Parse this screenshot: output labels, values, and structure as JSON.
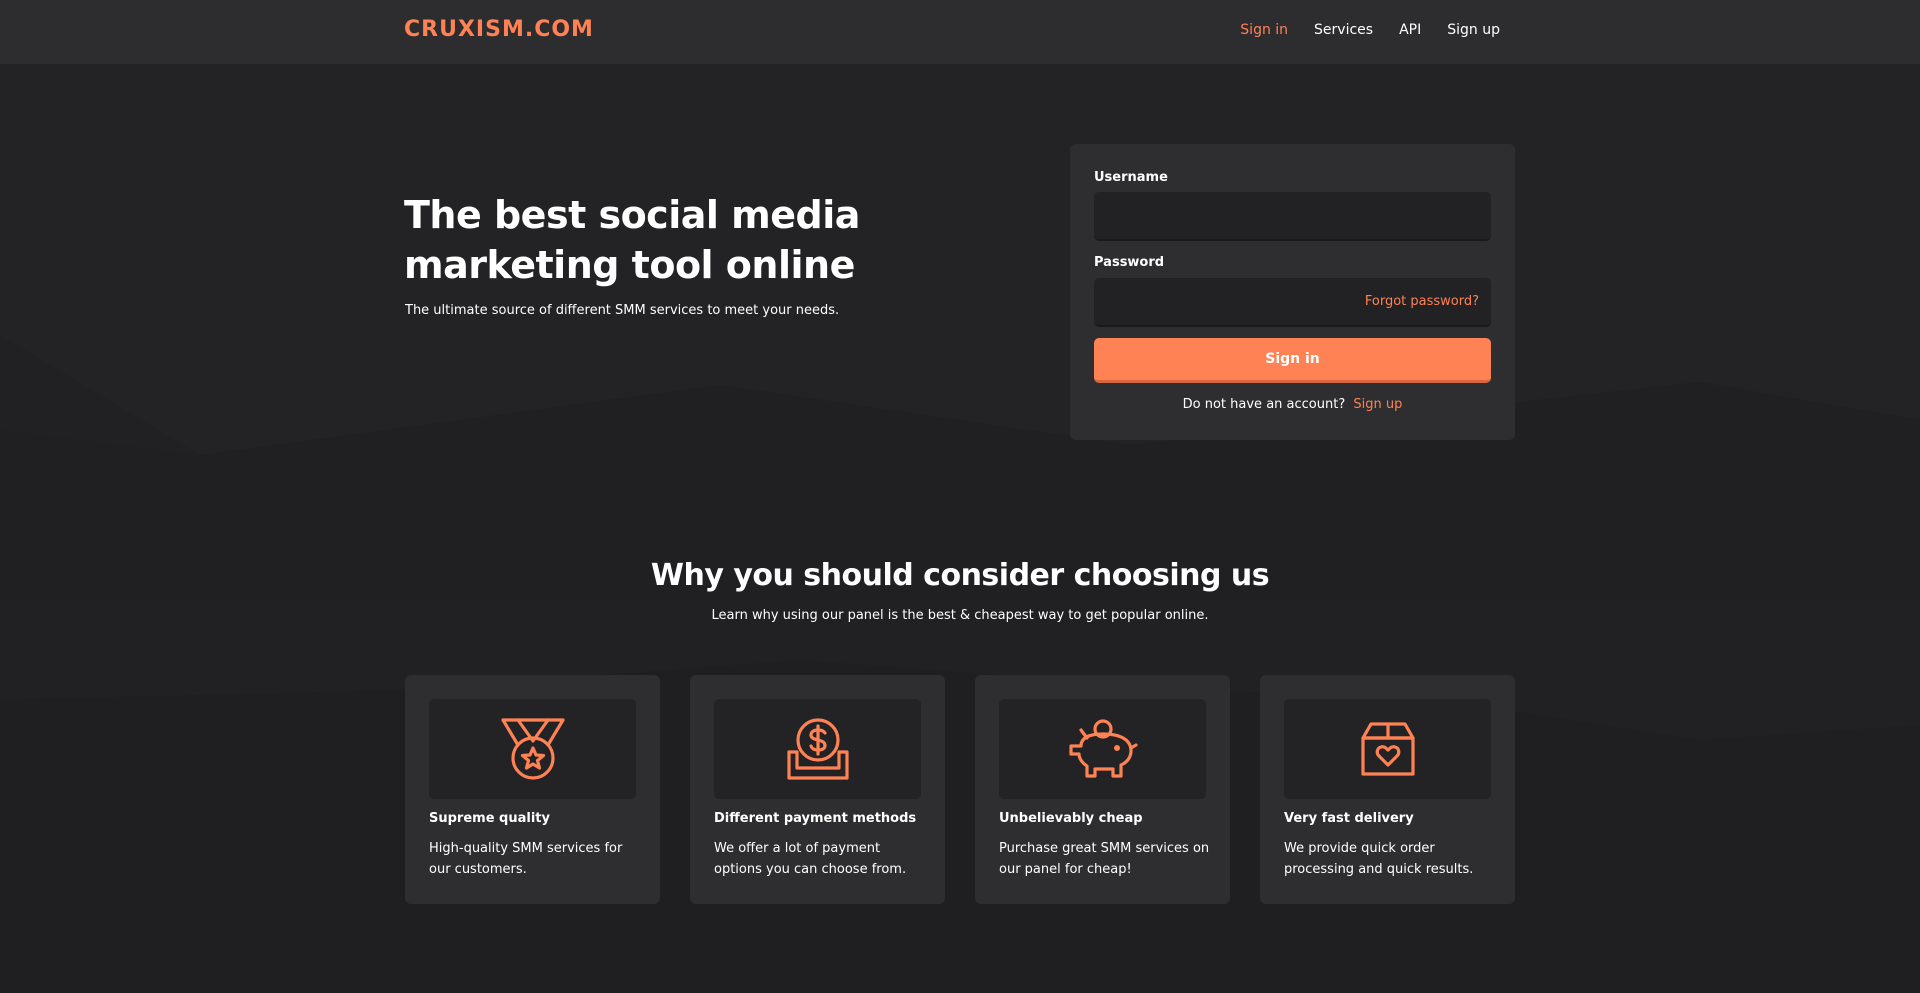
{
  "brand": {
    "name": "CRUXISM.COM",
    "accent_color": "#fe8254"
  },
  "nav": {
    "items": [
      {
        "label": "Sign in",
        "active": true
      },
      {
        "label": "Services",
        "active": false
      },
      {
        "label": "API",
        "active": false
      },
      {
        "label": "Sign up",
        "active": false
      }
    ]
  },
  "hero": {
    "title": "The best social media marketing tool online",
    "subtitle": "The ultimate source of different SMM services to meet your needs."
  },
  "login": {
    "username_label": "Username",
    "username_value": "",
    "password_label": "Password",
    "password_value": "",
    "forgot_label": "Forgot password?",
    "submit_label": "Sign in",
    "no_account_text": "Do not have an account?",
    "signup_link": "Sign up"
  },
  "why": {
    "title": "Why you should consider choosing us",
    "subtitle": "Learn why using our panel is the best & cheapest way to get popular online."
  },
  "features": [
    {
      "icon": "medal-icon",
      "title": "Supreme quality",
      "desc": "High-quality SMM services for our customers."
    },
    {
      "icon": "dollar-coin-icon",
      "title": "Different payment methods",
      "desc": "We offer a lot of payment options you can choose from."
    },
    {
      "icon": "piggy-bank-icon",
      "title": "Unbelievably cheap",
      "desc": "Purchase great SMM services on our panel for cheap!"
    },
    {
      "icon": "heart-box-icon",
      "title": "Very fast delivery",
      "desc": "We provide quick order processing and quick results."
    }
  ]
}
